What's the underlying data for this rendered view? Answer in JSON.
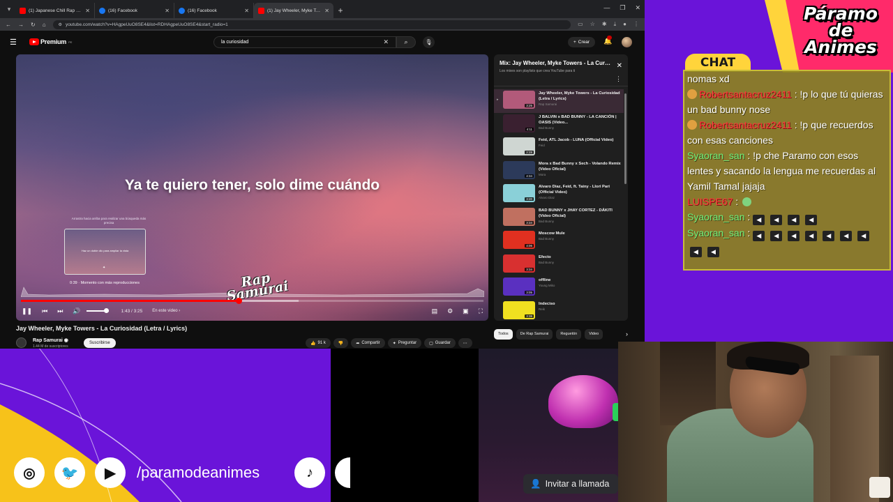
{
  "browser": {
    "tabs": [
      {
        "title": "(1) Japanese Chill Rap & Hip-H",
        "favicon": "youtube",
        "active": false
      },
      {
        "title": "(16) Facebook",
        "favicon": "facebook",
        "active": false
      },
      {
        "title": "(16) Facebook",
        "favicon": "facebook",
        "active": false
      },
      {
        "title": "(1) Jay Wheeler, Myke Towe",
        "favicon": "youtube",
        "active": true
      }
    ],
    "url": "youtube.com/watch?v=HAgpeUuO8SE4&list=RDHAgpeUuO8SE4&start_radio=1"
  },
  "youtube": {
    "logo": "Premium",
    "logo_country": "PE",
    "search_value": "la curiosidad",
    "create_label": "Crear"
  },
  "player": {
    "lyric": "Ya te quiero tener, solo dime cuándo",
    "hint": "Arrastra hacia arriba para realizar una búsqueda más precisa",
    "preview_text": "Haz un doble clic para ampliar la vista",
    "preview_time": "0:39 · Momento con más reproducciones",
    "watermark_line1": "Rap",
    "watermark_line2": "Samurai",
    "current_time": "1:43 / 3:25",
    "chapter": "En este video ›",
    "played_fraction": 0.47,
    "loaded_fraction": 0.6
  },
  "video": {
    "title": "Jay Wheeler, Myke Towers - La Curiosidad (Letra / Lyrics)",
    "channel": "Rap Samurai",
    "subscribers": "1.44 M de suscriptores",
    "subscribe_label": "Suscribirse",
    "likes": "91 k",
    "share_label": "Compartir",
    "ask_label": "Preguntar",
    "save_label": "Guardar"
  },
  "playlist": {
    "title": "Mix: Jay Wheeler, Myke Towers - La Curiosidad",
    "subtitle": "Los mixes son playlists que crea YouTube para ti",
    "items": [
      {
        "title": "Jay Wheeler, Myke Towers - La Curiosidad (Letra / Lyrics)",
        "channel": "Rap Samurai",
        "duration": "3:25",
        "color": "#b25a7a"
      },
      {
        "title": "J BALVIN x BAD BUNNY - LA CANCIÓN | OASIS (Video...",
        "channel": "Bad Bunny",
        "duration": "4:11",
        "color": "#3a2030"
      },
      {
        "title": "Feid, ATL Jacob - LUNA (Official Video)",
        "channel": "Feid",
        "duration": "2:28",
        "color": "#cfd6d2"
      },
      {
        "title": "Mora x Bad Bunny x Sech - Volando Remix (Video Oficial)",
        "channel": "Mora",
        "duration": "4:34",
        "color": "#2c3a5a"
      },
      {
        "title": "Alvaro Diaz, Feid, ft. Tainy - Llori Pari (Official Video)",
        "channel": "Alvaro Diaz",
        "duration": "3:20",
        "color": "#8ad0d8"
      },
      {
        "title": "BAD BUNNY x JHAY CORTEZ - DÁKITI (Video Oficial)",
        "channel": "Bad Bunny",
        "duration": "3:34",
        "color": "#c07060"
      },
      {
        "title": "Moscow Mule",
        "channel": "Bad Bunny",
        "duration": "4:06",
        "color": "#e03020"
      },
      {
        "title": "Efecto",
        "channel": "Bad Bunny",
        "duration": "3:34",
        "color": "#d83030"
      },
      {
        "title": "offline",
        "channel": "Young Miko",
        "duration": "3:05",
        "color": "#5a30c0"
      },
      {
        "title": "Indeciso",
        "channel": "Reik",
        "duration": "3:38",
        "color": "#f0e020"
      }
    ],
    "chips": [
      "Todos",
      "De Rap Samurai",
      "Reguetón",
      "Video"
    ]
  },
  "chat": {
    "label": "CHAT",
    "messages": [
      {
        "user": "",
        "text": "nomas xd",
        "style": "none",
        "icon": false
      },
      {
        "user": "Robertsantacruz2411",
        "text": ": !p lo que tú quieras un bad bunny nose",
        "style": "red",
        "icon": true
      },
      {
        "user": "Robertsantacruz2411",
        "text": ": !p que recuerdos con esas canciones",
        "style": "red",
        "icon": true
      },
      {
        "user": "Syaoran_san",
        "text": ": !p che Paramo con esos lentes y sacando la lengua me recuerdas al Yamil Tamal jajaja",
        "style": "green",
        "icon": false
      },
      {
        "user": "LUISPE67",
        "text": ":",
        "style": "red",
        "icon": false,
        "smiley": true
      },
      {
        "user": "Syaoran_san",
        "text": ":",
        "style": "green",
        "icon": false,
        "emotes": 4
      },
      {
        "user": "Syaoran_san",
        "text": ":",
        "style": "green",
        "icon": false,
        "emotes": 9
      }
    ]
  },
  "stream": {
    "brand": "Páramo de Animes",
    "handle": "/paramodeanimes",
    "invite_label": "Invitar a llamada"
  }
}
